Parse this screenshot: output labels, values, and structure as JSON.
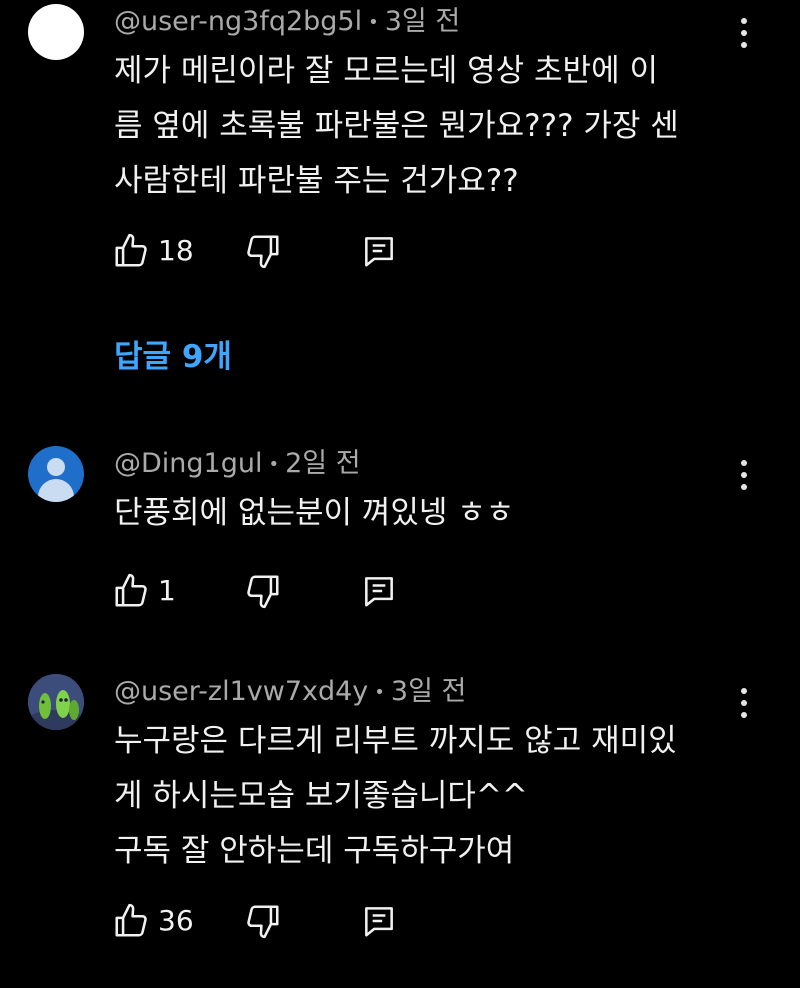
{
  "comments": [
    {
      "author": "@user-ng3fq2bg5l",
      "separator": "•",
      "time": "3일 전",
      "lines": [
        "제가 메린이라 잘 모르는데 영상 초반에 이",
        "름 옆에 초록불 파란불은 뭔가요??? 가장 센",
        "사람한테 파란불 주는 건가요??"
      ],
      "likes": "18",
      "avatar_color": "#ffffff"
    },
    {
      "author": "@Ding1gul",
      "separator": "•",
      "time": "2일 전",
      "lines": [
        "단풍회에 없는분이 껴있넹 ㅎㅎ"
      ],
      "likes": "1",
      "avatar_color": "#1f6ec9"
    },
    {
      "author": "@user-zl1vw7xd4y",
      "separator": "•",
      "time": "3일 전",
      "lines": [
        "누구랑은 다르게 리부트 까지도 않고 재미있",
        "게 하시는모습 보기좋습니다^^",
        "구독 잘 안하는데 구독하구가여"
      ],
      "likes": "36",
      "avatar_color": "#40507a"
    }
  ],
  "replies_label": "답글 9개",
  "icons": {
    "like": "thumb-up-icon",
    "dislike": "thumb-down-icon",
    "reply": "reply-icon",
    "more": "more-vert-icon"
  },
  "colors": {
    "background": "#000000",
    "text": "#f1f1f1",
    "meta": "#aaaaaa",
    "link": "#3ea6ff"
  }
}
